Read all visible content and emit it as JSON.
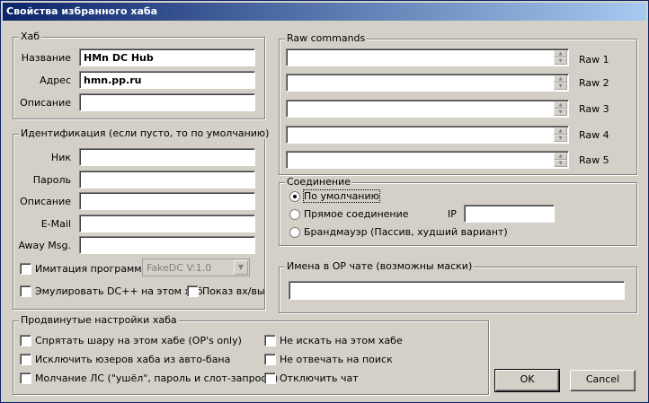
{
  "window": {
    "title": "Свойства избранного хаба"
  },
  "hub": {
    "legend": "Хаб",
    "name_label": "Название",
    "name_value": "HMn DC Hub",
    "address_label": "Адрес",
    "address_value": "hmn.pp.ru",
    "description_label": "Описание",
    "description_value": ""
  },
  "identity": {
    "legend": "Идентификация (если пусто, то по умолчанию)",
    "nick_label": "Ник",
    "password_label": "Пароль",
    "description_label": "Описание",
    "email_label": "E-Mail",
    "away_label": "Away Msg.",
    "emulate_label": "Имитация программы",
    "emulate_checked": false,
    "client_select": "FakeDC V:1.0",
    "emulate_dcpp_label": "Эмулировать DC++ на этом хаб",
    "emulate_dcpp_checked": false,
    "show_label": "Показ вх/вы",
    "show_checked": false
  },
  "raw": {
    "legend": "Raw commands",
    "items": [
      "Raw 1",
      "Raw 2",
      "Raw 3",
      "Raw 4",
      "Raw 5"
    ]
  },
  "connection": {
    "legend": "Соединение",
    "default_label": "По умолчанию",
    "direct_label": "Прямое соединение",
    "ip_label": "IP",
    "ip_value": "",
    "firewall_label": "Брандмауэр (Пассив, худший вариант)",
    "selected": "default"
  },
  "op_chat": {
    "legend": "Имена в OP чате (возможны маски)",
    "value": ""
  },
  "advanced": {
    "legend": "Продвинутые настройки хаба",
    "hide_share": "Спрятать шару на этом хабе (OP's only)",
    "exclude_users": "Исключить юзеров хаба из авто-бана",
    "silence_pm": "Молчание ЛС (\"ушёл\", пароль и слот-запросы)",
    "no_search": "Не искать на этом хабе",
    "no_reply_search": "Не отвечать на поиск",
    "disable_chat": "Отключить чат"
  },
  "buttons": {
    "ok": "OK",
    "cancel": "Cancel"
  }
}
